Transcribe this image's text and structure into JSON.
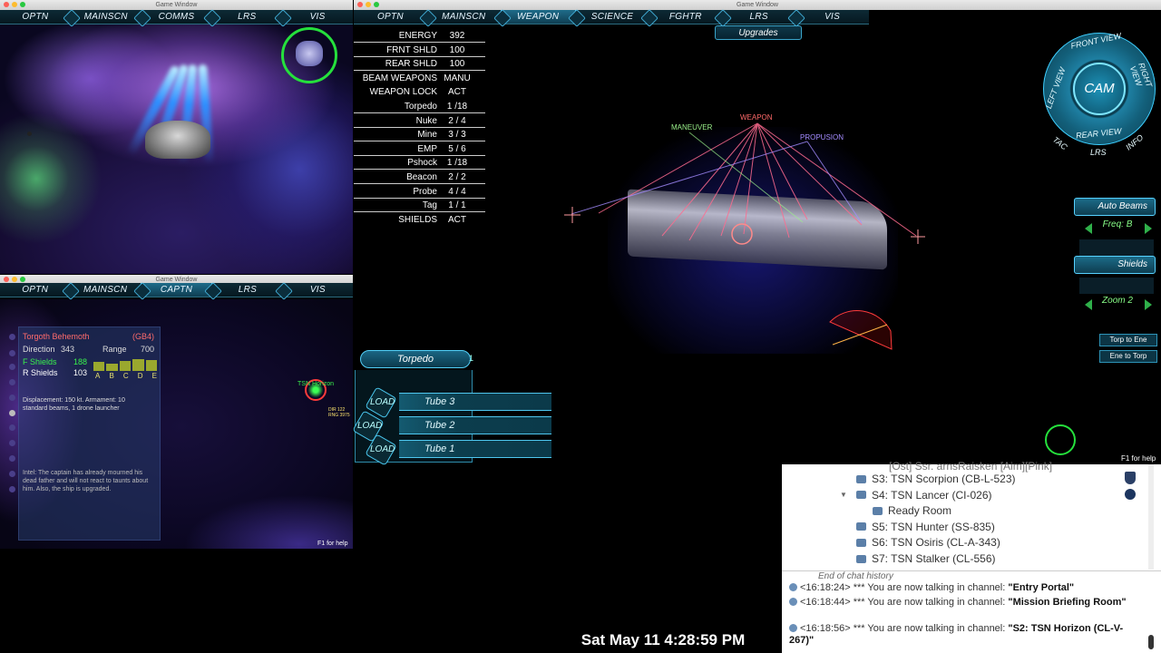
{
  "window_title": "Game Window",
  "win_top_left": {
    "tabs": [
      "OPTN",
      "MAINSCN",
      "COMMS",
      "LRS",
      "VIS"
    ],
    "active_tab": ""
  },
  "win_bottom_left": {
    "tabs": [
      "OPTN",
      "MAINSCN",
      "CAPTN",
      "LRS",
      "VIS"
    ],
    "active_tab": "CAPTN",
    "target": {
      "name": "Torgoth Behemoth",
      "code": "(GB4)",
      "direction_label": "Direction",
      "direction": "343",
      "range_label": "Range",
      "range": "700",
      "fshields_label": "F Shields",
      "fshields": "188",
      "rshields_label": "R Shields",
      "rshields": "103",
      "freq_letters": [
        "A",
        "B",
        "C",
        "D",
        "E"
      ],
      "description": "Displacement: 150 kt. Armament: 10 standard beams, 1 drone launcher",
      "intel": "Intel: The captain has already mourned his dead father and will not react to taunts about him.  Also, the ship is upgraded."
    },
    "contact_label": "TSN Horizon",
    "contact_sub": "DIR 122 RNG 3975",
    "help": "F1 for help"
  },
  "win_main": {
    "tabs": [
      "OPTN",
      "MAINSCN",
      "WEAPON",
      "SCIENCE",
      "FGHTR",
      "LRS",
      "VIS"
    ],
    "active_tab": "WEAPON",
    "upgrades": "Upgrades",
    "stats": [
      {
        "label": "ENERGY",
        "value": "392"
      },
      {
        "label": "FRNT SHLD",
        "value": "100"
      },
      {
        "label": "REAR SHLD",
        "value": "100"
      },
      {
        "label": "BEAM WEAPONS",
        "value": "MANU"
      },
      {
        "label": "WEAPON LOCK",
        "value": "ACT"
      },
      {
        "label": "Torpedo",
        "value": "1 /18"
      },
      {
        "label": "Nuke",
        "value": "2 /  4"
      },
      {
        "label": "Mine",
        "value": "3 /  3"
      },
      {
        "label": "EMP",
        "value": "5 /  6"
      },
      {
        "label": "Pshock",
        "value": "1 /18"
      },
      {
        "label": "Beacon",
        "value": "2 /  2"
      },
      {
        "label": "Probe",
        "value": "4 /  4"
      },
      {
        "label": "Tag",
        "value": "1 /  1"
      },
      {
        "label": "SHIELDS",
        "value": "ACT"
      }
    ],
    "ship_labels": {
      "maneuver": "MANEUVER",
      "weapon": "WEAPON",
      "propulsion": "PROPUSION"
    },
    "torpedo_select": "Torpedo",
    "torpedo_count": "1",
    "tubes": [
      {
        "load": "LOAD",
        "name": "Tube 3"
      },
      {
        "load": "LOAD",
        "name": "Tube 2"
      },
      {
        "load": "LOAD",
        "name": "Tube 1"
      }
    ],
    "cam": {
      "center": "CAM",
      "front": "FRONT VIEW",
      "right": "RIGHT VIEW",
      "left": "LEFT VIEW",
      "rear": "REAR VIEW",
      "tac": "TAC",
      "lrs": "LRS",
      "info": "INFO"
    },
    "auto_beams": "Auto Beams",
    "freq": "Freq: B",
    "shields": "Shields",
    "zoom": "Zoom 2",
    "torp_to_ene": "Torp to Ene",
    "ene_to_torp": "Ene to Torp",
    "help": "F1 for help"
  },
  "chat": {
    "channels_top_cut": "[Ost] Ssr. arnsRaisken [Aim][Pink]",
    "channels": [
      {
        "label": "S3: TSN Scorpion (CB-L-523)",
        "indent": 0,
        "arrow": ""
      },
      {
        "label": "S4: TSN Lancer (CI-026)",
        "indent": 0,
        "arrow": "▼"
      },
      {
        "label": "Ready Room",
        "indent": 1,
        "arrow": ""
      },
      {
        "label": "S5: TSN Hunter (SS-835)",
        "indent": 0,
        "arrow": ""
      },
      {
        "label": "S6: TSN Osiris (CL-A-343)",
        "indent": 0,
        "arrow": ""
      },
      {
        "label": "S7: TSN Stalker (CL-556)",
        "indent": 0,
        "arrow": ""
      }
    ],
    "history_end": "End of chat history",
    "messages": [
      {
        "time": "<16:18:24>",
        "text": "*** You are now talking in channel: ",
        "channel": "\"Entry Portal\""
      },
      {
        "time": "<16:18:44>",
        "text": "*** You are now talking in channel: ",
        "channel": "\"Mission Briefing Room\""
      },
      {
        "time": "<16:18:56>",
        "text": "*** You are now talking in channel: ",
        "channel": "\"S2: TSN Horizon (CL-V-267)\""
      }
    ]
  },
  "clock": "Sat May 11  4:28:59 PM",
  "colors": {
    "hud_green": "#25e03c",
    "accent_cyan": "#4fc7ef",
    "weapon_red": "#ff6a6a",
    "maneuver_green": "#9af08a",
    "propulsion_purple": "#a48cff"
  }
}
